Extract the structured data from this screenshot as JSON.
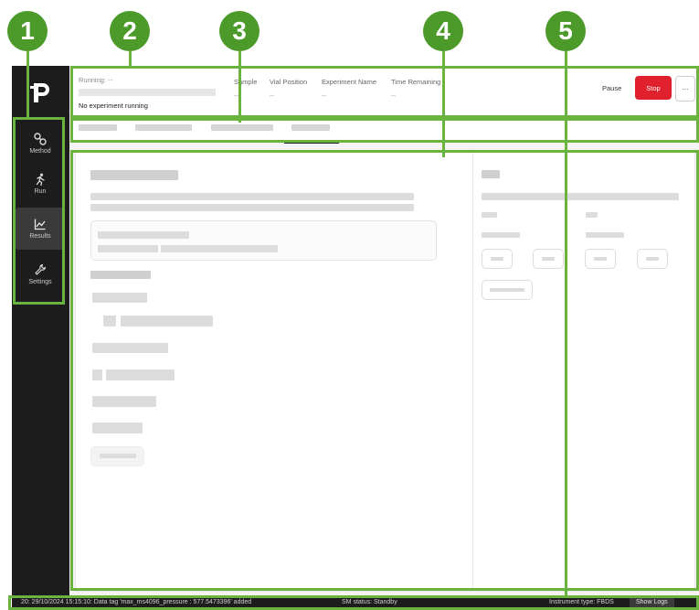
{
  "callouts": [
    "1",
    "2",
    "3",
    "4",
    "5"
  ],
  "sidebar": {
    "logo_icon": "p-logo-icon",
    "items": [
      {
        "label": "Method",
        "icon": "method-icon"
      },
      {
        "label": "Run",
        "icon": "run-icon"
      },
      {
        "label": "Results",
        "icon": "results-icon"
      },
      {
        "label": "Settings",
        "icon": "wrench-icon"
      }
    ],
    "active": "Results"
  },
  "header": {
    "running_label": "Running:  --",
    "status_text": "No experiment running",
    "columns": [
      {
        "label": "Sample",
        "value": "--"
      },
      {
        "label": "Vial Position",
        "value": "--"
      },
      {
        "label": "Experiment Name",
        "value": "--"
      },
      {
        "label": "Time Remaining",
        "value": "--"
      }
    ],
    "pause_label": "Pause",
    "stop_label": "Stop",
    "more_label": "..."
  },
  "statusbar": {
    "log_text": "20: 29/10/2024 15:15:10: Data tag 'max_ms4096_pressure : 577.5473396' added",
    "sm_status": "SM status: Standby",
    "instrument": "Instrument type: FBDS",
    "show_logs": "Show Logs"
  },
  "colors": {
    "accent": "#6bb33f",
    "callout": "#4b9a2a",
    "stop": "#e0202c",
    "sidebar": "#1d1d1d"
  }
}
